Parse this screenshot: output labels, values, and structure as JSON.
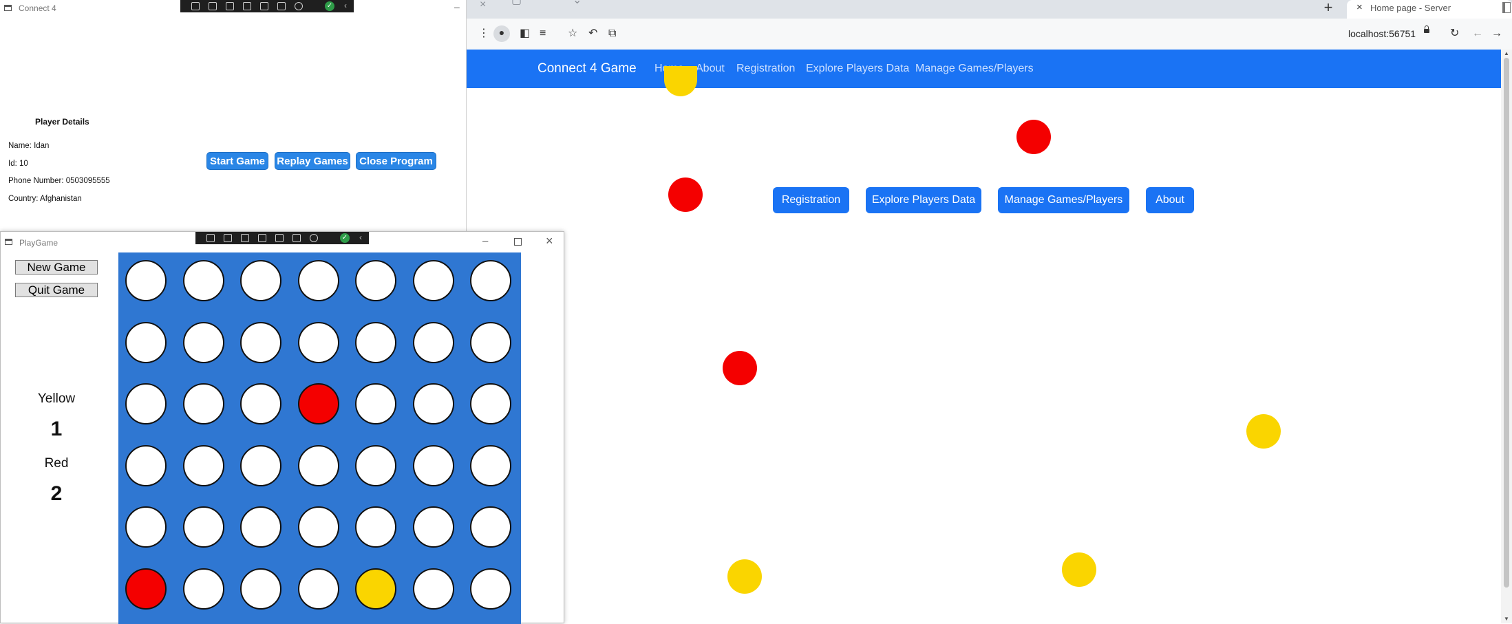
{
  "browser": {
    "tab_title": "Home page - Server",
    "url": "localhost:56751",
    "toolbar_icons": [
      "menu-icon",
      "profile-icon",
      "sidebar-icon",
      "reading-list-icon",
      "star-icon",
      "share-icon",
      "extensions-icon"
    ],
    "nav_icons": [
      "reload-icon",
      "back-icon",
      "forward-icon"
    ]
  },
  "site": {
    "brand": "Connect 4 Game",
    "nav": [
      "Home",
      "About",
      "Registration",
      "Explore Players Data",
      "Manage Games/Players"
    ],
    "buttons": [
      "Registration",
      "Explore Players Data",
      "Manage Games/Players",
      "About"
    ],
    "colors": {
      "navbar": "#1a73f4",
      "red_ball": "#f40000",
      "yellow_ball": "#fad500"
    }
  },
  "connect4_window": {
    "title": "Connect 4",
    "player_details": {
      "heading": "Player Details",
      "name": "Name: Idan",
      "id": "Id: 10",
      "phone": "Phone Number: 0503095555",
      "country": "Country: Afghanistan"
    },
    "buttons": [
      "Start Game",
      "Replay Games",
      "Close Program"
    ]
  },
  "playgame_window": {
    "title": "PlayGame",
    "buttons": {
      "new_game": "New Game",
      "quit_game": "Quit Game"
    },
    "scores": {
      "yellow_label": "Yellow",
      "yellow_value": "1",
      "red_label": "Red",
      "red_value": "2"
    },
    "board": {
      "rows": 6,
      "cols": 7,
      "cells": [
        [
          "empty",
          "empty",
          "empty",
          "empty",
          "empty",
          "empty",
          "empty"
        ],
        [
          "empty",
          "empty",
          "empty",
          "empty",
          "empty",
          "empty",
          "empty"
        ],
        [
          "empty",
          "empty",
          "empty",
          "red",
          "empty",
          "empty",
          "empty"
        ],
        [
          "empty",
          "empty",
          "empty",
          "empty",
          "empty",
          "empty",
          "empty"
        ],
        [
          "empty",
          "empty",
          "empty",
          "empty",
          "empty",
          "empty",
          "empty"
        ],
        [
          "red",
          "empty",
          "empty",
          "empty",
          "yellow",
          "empty",
          "empty"
        ]
      ]
    }
  }
}
